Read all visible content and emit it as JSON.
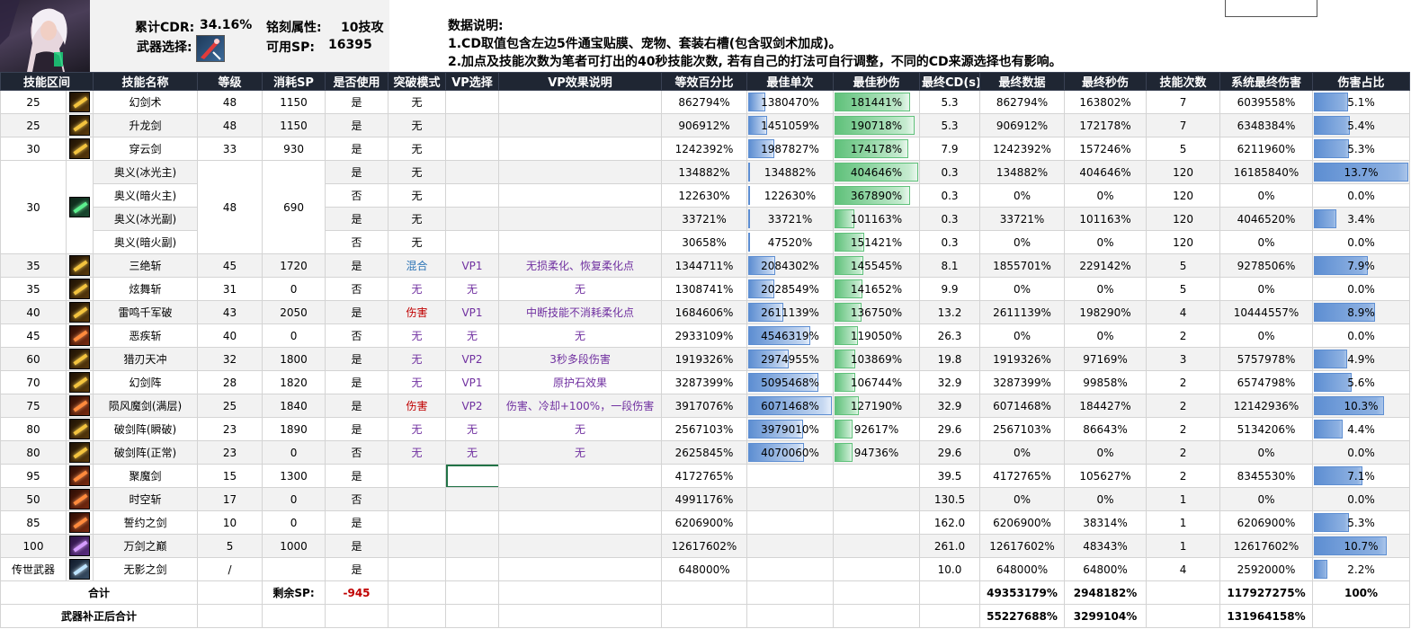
{
  "summary": {
    "cdr_label": "累计CDR:",
    "cdr_value": "34.16%",
    "inscription_label": "铭刻属性:",
    "inscription_value": "10技攻",
    "weapon_label": "武器选择:",
    "sp_label": "可用SP:",
    "sp_value": "16395"
  },
  "notes": {
    "title": "数据说明:",
    "line1": "1.CD取值包含左边5件通宝贴膜、宠物、套装右槽(包含驭剑术加成)。",
    "line2": "2.加点及技能次数为笔者可打出的40秒技能次数, 若有自己的打法可自行调整，不同的CD来源选择也有影响。"
  },
  "headers": [
    "技能区间",
    "技能名称",
    "等级",
    "消耗SP",
    "是否使用",
    "突破模式",
    "VP选择",
    "VP效果说明",
    "等效百分比",
    "最佳单次",
    "最佳秒伤",
    "最终CD(s)",
    "最终数据",
    "最终秒伤",
    "技能次数",
    "系统最终伤害",
    "伤害占比"
  ],
  "rows": [
    {
      "range": "25",
      "icon": "sword-icon",
      "name": "幻剑术",
      "level": "48",
      "sp": "1150",
      "use": "是",
      "mode": "无",
      "vp": "",
      "vpdesc": "",
      "eq": "862794%",
      "single": "1380470%",
      "single_frac": 0.22,
      "dps": "181441%",
      "dps_frac": 0.91,
      "cd": "5.3",
      "final": "862794%",
      "fdps": "163802%",
      "count": "7",
      "sys": "6039558%",
      "share": "5.1%",
      "share_frac": 0.37
    },
    {
      "range": "25",
      "icon": "sword-icon",
      "name": "升龙剑",
      "level": "48",
      "sp": "1150",
      "use": "是",
      "mode": "无",
      "vp": "",
      "vpdesc": "",
      "eq": "906912%",
      "single": "1451059%",
      "single_frac": 0.24,
      "dps": "190718%",
      "dps_frac": 0.96,
      "cd": "5.3",
      "final": "906912%",
      "fdps": "172178%",
      "count": "7",
      "sys": "6348384%",
      "share": "5.4%",
      "share_frac": 0.39
    },
    {
      "range": "30",
      "icon": "sword-icon",
      "name": "穿云剑",
      "level": "33",
      "sp": "930",
      "use": "是",
      "mode": "无",
      "vp": "",
      "vpdesc": "",
      "eq": "1242392%",
      "single": "1987827%",
      "single_frac": 0.33,
      "dps": "174178%",
      "dps_frac": 0.88,
      "cd": "7.9",
      "final": "1242392%",
      "fdps": "157246%",
      "count": "5",
      "sys": "6211960%",
      "share": "5.3%",
      "share_frac": 0.38
    },
    {
      "range": "30",
      "icon": "ice-fire-icon",
      "name": "奥义(冰光主)",
      "level": "48",
      "sp": "690",
      "use": "是",
      "mode": "无",
      "vp": "",
      "vpdesc": "",
      "eq": "134882%",
      "single": "134882%",
      "single_frac": 0.02,
      "dps": "404646%",
      "dps_frac": 1.0,
      "cd": "0.3",
      "final": "134882%",
      "fdps": "404646%",
      "count": "120",
      "sys": "16185840%",
      "share": "13.7%",
      "share_frac": 1.0
    },
    {
      "range": "30",
      "icon": "ice-fire-icon",
      "name": "奥义(暗火主)",
      "level": "48",
      "sp": "690",
      "use": "否",
      "mode": "无",
      "vp": "",
      "vpdesc": "",
      "eq": "122630%",
      "single": "122630%",
      "single_frac": 0.02,
      "dps": "367890%",
      "dps_frac": 0.9,
      "cd": "0.3",
      "final": "0%",
      "fdps": "0%",
      "count": "120",
      "sys": "0%",
      "share": "0.0%",
      "share_frac": 0
    },
    {
      "range": "30",
      "icon": "ice-fire-icon",
      "name": "奥义(冰光副)",
      "level": "48",
      "sp": "690",
      "use": "是",
      "mode": "无",
      "vp": "",
      "vpdesc": "",
      "eq": "33721%",
      "single": "33721%",
      "single_frac": 0.01,
      "dps": "101163%",
      "dps_frac": 0.25,
      "cd": "0.3",
      "final": "33721%",
      "fdps": "101163%",
      "count": "120",
      "sys": "4046520%",
      "share": "3.4%",
      "share_frac": 0.25
    },
    {
      "range": "30",
      "icon": "ice-fire-icon",
      "name": "奥义(暗火副)",
      "level": "48",
      "sp": "690",
      "use": "否",
      "mode": "无",
      "vp": "",
      "vpdesc": "",
      "eq": "30658%",
      "single": "47520%",
      "single_frac": 0.01,
      "dps": "151421%",
      "dps_frac": 0.37,
      "cd": "0.3",
      "final": "0%",
      "fdps": "0%",
      "count": "120",
      "sys": "0%",
      "share": "0.0%",
      "share_frac": 0
    },
    {
      "range": "35",
      "icon": "sword-icon",
      "name": "三绝斩",
      "level": "45",
      "sp": "1720",
      "use": "是",
      "mode": "混合",
      "mode_color": "teal",
      "vp": "VP1",
      "vpdesc": "无损柔化、恢复柔化点",
      "eq": "1344711%",
      "single": "2084302%",
      "single_frac": 0.34,
      "dps": "145545%",
      "dps_frac": 0.36,
      "cd": "8.1",
      "final": "1855701%",
      "fdps": "229142%",
      "count": "5",
      "sys": "9278506%",
      "share": "7.9%",
      "share_frac": 0.58
    },
    {
      "range": "35",
      "icon": "moon-icon",
      "name": "炫舞斩",
      "level": "31",
      "sp": "0",
      "use": "否",
      "mode": "无",
      "vp": "无",
      "vpdesc": "无",
      "eq": "1308741%",
      "single": "2028549%",
      "single_frac": 0.33,
      "dps": "141652%",
      "dps_frac": 0.35,
      "cd": "9.9",
      "final": "0%",
      "fdps": "0%",
      "count": "5",
      "sys": "0%",
      "share": "0.0%",
      "share_frac": 0
    },
    {
      "range": "40",
      "icon": "burst-icon",
      "name": "雷鸣千军破",
      "level": "43",
      "sp": "2050",
      "use": "是",
      "mode": "伤害",
      "mode_color": "red",
      "vp": "VP1",
      "vpdesc": "中断技能不消耗柔化点",
      "eq": "1684606%",
      "single": "2611139%",
      "single_frac": 0.43,
      "dps": "136750%",
      "dps_frac": 0.34,
      "cd": "13.2",
      "final": "2611139%",
      "fdps": "198290%",
      "count": "4",
      "sys": "10444557%",
      "share": "8.9%",
      "share_frac": 0.65
    },
    {
      "range": "45",
      "icon": "slash-icon",
      "name": "恶疾斩",
      "level": "40",
      "sp": "0",
      "use": "否",
      "mode": "无",
      "vp": "无",
      "vpdesc": "无",
      "eq": "2933109%",
      "single": "4546319%",
      "single_frac": 0.75,
      "dps": "119050%",
      "dps_frac": 0.29,
      "cd": "26.3",
      "final": "0%",
      "fdps": "0%",
      "count": "2",
      "sys": "0%",
      "share": "0.0%",
      "share_frac": 0
    },
    {
      "range": "60",
      "icon": "sword-icon",
      "name": "猎刃天冲",
      "level": "32",
      "sp": "1800",
      "use": "是",
      "mode": "无",
      "vp": "VP2",
      "vpdesc": "3秒多段伤害",
      "eq": "1919326%",
      "single": "2974955%",
      "single_frac": 0.49,
      "dps": "103869%",
      "dps_frac": 0.26,
      "cd": "19.8",
      "final": "1919326%",
      "fdps": "97169%",
      "count": "3",
      "sys": "5757978%",
      "share": "4.9%",
      "share_frac": 0.36
    },
    {
      "range": "70",
      "icon": "sword-icon",
      "name": "幻剑阵",
      "level": "28",
      "sp": "1820",
      "use": "是",
      "mode": "无",
      "vp": "VP1",
      "vpdesc": "原护石效果",
      "eq": "3287399%",
      "single": "5095468%",
      "single_frac": 0.84,
      "dps": "106744%",
      "dps_frac": 0.26,
      "cd": "32.9",
      "final": "3287399%",
      "fdps": "99858%",
      "count": "2",
      "sys": "6574798%",
      "share": "5.6%",
      "share_frac": 0.41
    },
    {
      "range": "75",
      "icon": "slash-icon",
      "name": "陨风魔剑(满层)",
      "level": "25",
      "sp": "1840",
      "use": "是",
      "mode": "伤害",
      "mode_color": "red",
      "vp": "VP2",
      "vpdesc": "伤害、冷却+100%，一段伤害",
      "eq": "3917076%",
      "single": "6071468%",
      "single_frac": 1.0,
      "dps": "127190%",
      "dps_frac": 0.31,
      "cd": "32.9",
      "final": "6071468%",
      "fdps": "184427%",
      "count": "2",
      "sys": "12142936%",
      "share": "10.3%",
      "share_frac": 0.75
    },
    {
      "range": "80",
      "icon": "sword-icon",
      "name": "破剑阵(瞬破)",
      "level": "23",
      "sp": "1890",
      "use": "是",
      "mode": "无",
      "vp": "无",
      "vpdesc": "无",
      "eq": "2567103%",
      "single": "3979010%",
      "single_frac": 0.66,
      "dps": "92617%",
      "dps_frac": 0.23,
      "cd": "29.6",
      "final": "2567103%",
      "fdps": "86643%",
      "count": "2",
      "sys": "5134206%",
      "share": "4.4%",
      "share_frac": 0.32
    },
    {
      "range": "80",
      "icon": "sword-icon",
      "name": "破剑阵(正常)",
      "level": "23",
      "sp": "0",
      "use": "否",
      "mode": "无",
      "vp": "无",
      "vpdesc": "无",
      "eq": "2625845%",
      "single": "4070060%",
      "single_frac": 0.67,
      "dps": "94736%",
      "dps_frac": 0.23,
      "cd": "29.6",
      "final": "0%",
      "fdps": "0%",
      "count": "2",
      "sys": "0%",
      "share": "0.0%",
      "share_frac": 0
    },
    {
      "range": "95",
      "icon": "demon-sword-icon",
      "name": "聚魔剑",
      "level": "15",
      "sp": "1300",
      "use": "是",
      "mode": "",
      "vp": "",
      "vpdesc": "",
      "eq": "4172765%",
      "single": "",
      "single_frac": 0,
      "dps": "",
      "dps_frac": 0,
      "cd": "39.5",
      "final": "4172765%",
      "fdps": "105627%",
      "count": "2",
      "sys": "8345530%",
      "share": "7.1%",
      "share_frac": 0.52,
      "selected": true
    },
    {
      "range": "50",
      "icon": "demon-sword-icon",
      "name": "时空斩",
      "level": "17",
      "sp": "0",
      "use": "否",
      "mode": "",
      "vp": "",
      "vpdesc": "",
      "eq": "4991176%",
      "single": "",
      "single_frac": 0,
      "dps": "",
      "dps_frac": 0,
      "cd": "130.5",
      "final": "0%",
      "fdps": "0%",
      "count": "1",
      "sys": "0%",
      "share": "0.0%",
      "share_frac": 0
    },
    {
      "range": "85",
      "icon": "demon-sword-icon",
      "name": "誓约之剑",
      "level": "10",
      "sp": "0",
      "use": "是",
      "mode": "",
      "vp": "",
      "vpdesc": "",
      "eq": "6206900%",
      "single": "",
      "single_frac": 0,
      "dps": "",
      "dps_frac": 0,
      "cd": "162.0",
      "final": "6206900%",
      "fdps": "38314%",
      "count": "1",
      "sys": "6206900%",
      "share": "5.3%",
      "share_frac": 0.38
    },
    {
      "range": "100",
      "icon": "purple-sword-icon",
      "name": "万剑之巅",
      "level": "5",
      "sp": "1000",
      "use": "是",
      "mode": "",
      "vp": "",
      "vpdesc": "",
      "eq": "12617602%",
      "single": "",
      "single_frac": 0,
      "dps": "",
      "dps_frac": 0,
      "cd": "261.0",
      "final": "12617602%",
      "fdps": "48343%",
      "count": "1",
      "sys": "12617602%",
      "share": "10.7%",
      "share_frac": 0.78
    },
    {
      "range": "传世武器",
      "icon": "legendary-weapon-icon",
      "name": "无影之剑",
      "level": "/",
      "sp": "",
      "use": "是",
      "mode": "",
      "vp": "",
      "vpdesc": "",
      "eq": "648000%",
      "single": "",
      "single_frac": 0,
      "dps": "",
      "dps_frac": 0,
      "cd": "10.0",
      "final": "648000%",
      "fdps": "64800%",
      "count": "4",
      "sys": "2592000%",
      "share": "2.2%",
      "share_frac": 0.16
    }
  ],
  "totals": {
    "label": "合计",
    "remain_label": "剩余SP:",
    "remain_value": "-945",
    "final": "49353179%",
    "fdps": "2948182%",
    "sys": "117927275%",
    "share": "100%"
  },
  "weapon_totals": {
    "label": "武器补正后合计",
    "final": "55227688%",
    "fdps": "3299104%",
    "sys": "131964158%"
  }
}
